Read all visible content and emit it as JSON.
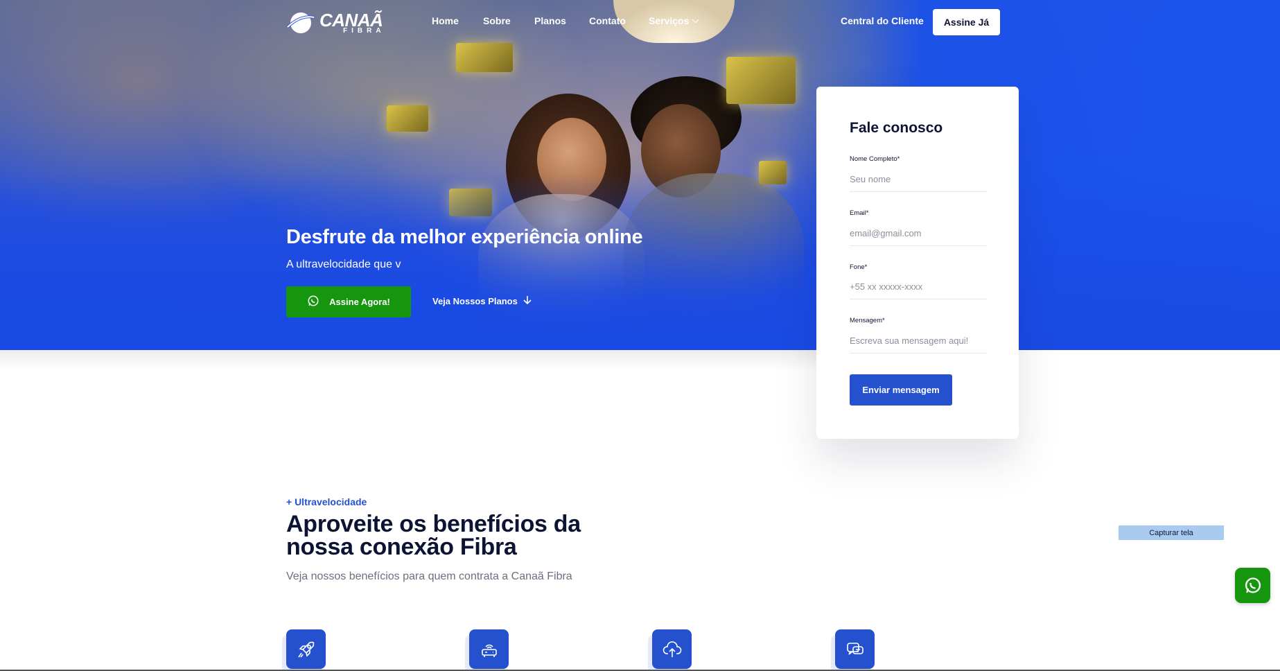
{
  "brand": {
    "name": "CANAÃ",
    "sub": "FIBRA",
    "accent": "#2551cf",
    "green": "#16960f"
  },
  "nav": {
    "items": [
      {
        "label": "Home"
      },
      {
        "label": "Sobre"
      },
      {
        "label": "Planos"
      },
      {
        "label": "Contato"
      },
      {
        "label": "Serviços",
        "icon": "chevron-down-icon"
      }
    ],
    "central": "Central do Cliente",
    "cta": "Assine Já"
  },
  "hero": {
    "title": "Desfrute da melhor experiência online",
    "subtitle": "A ultravelocidade que v",
    "primary_button": "Assine Agora!",
    "secondary_button": "Veja Nossos Planos"
  },
  "form": {
    "title": "Fale conosco",
    "fields": [
      {
        "label": "Nome Completo*",
        "placeholder": "Seu nome"
      },
      {
        "label": "Email*",
        "placeholder": "email@gmail.com"
      },
      {
        "label": "Fone*",
        "placeholder": "+55 xx xxxxx-xxxx"
      },
      {
        "label": "Mensagem*",
        "placeholder": "Escreva sua mensagem aqui!"
      }
    ],
    "submit": "Enviar mensagem"
  },
  "benefits": {
    "kicker": "+ Ultravelocidade",
    "title": "Aproveite os benefícios da nossa conexão Fibra",
    "description": "Veja nossos benefícios para quem contrata a Canaã Fibra",
    "icons": [
      "rocket-icon",
      "router-icon",
      "cloud-upload-icon",
      "chat-support-icon"
    ]
  },
  "overlay": {
    "capture_label": "Capturar tela",
    "whatsapp_icon": "whatsapp-icon"
  }
}
